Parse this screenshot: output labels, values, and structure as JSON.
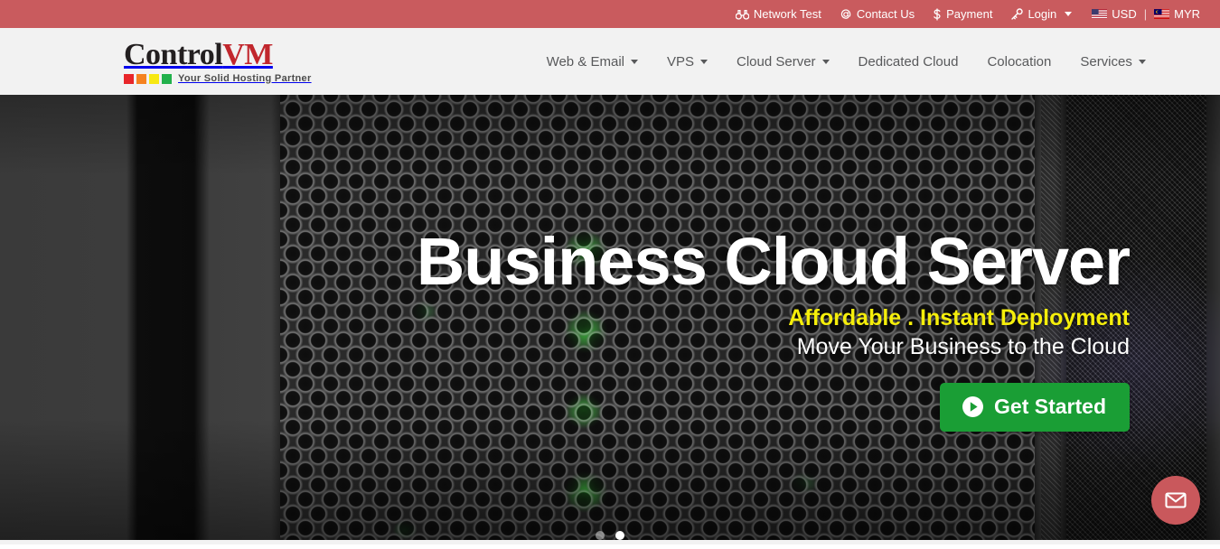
{
  "topbar": {
    "items": [
      {
        "label": "Network Test",
        "icon": "binoculars-icon"
      },
      {
        "label": "Contact Us",
        "icon": "at-sign-icon"
      },
      {
        "label": "Payment",
        "icon": "dollar-sign-icon"
      },
      {
        "label": "Login",
        "icon": "key-icon",
        "has_caret": true
      }
    ],
    "currencies": [
      {
        "label": "USD",
        "flag": "us-flag-icon"
      },
      {
        "label": "MYR",
        "flag": "my-flag-icon"
      }
    ],
    "separator": "|",
    "bg_color": "#c95b5e"
  },
  "header": {
    "logo": {
      "part1": "Control",
      "part2": "VM",
      "tagline": "Your Solid Hosting Partner",
      "squares": [
        "#e8262a",
        "#f58220",
        "#f7e812",
        "#22b14c"
      ]
    },
    "nav": [
      {
        "label": "Web & Email",
        "has_caret": true
      },
      {
        "label": "VPS",
        "has_caret": true
      },
      {
        "label": "Cloud Server",
        "has_caret": true
      },
      {
        "label": "Dedicated Cloud",
        "has_caret": false
      },
      {
        "label": "Colocation",
        "has_caret": false
      },
      {
        "label": "Services",
        "has_caret": true
      }
    ],
    "bg_color": "#f2f2f2",
    "nav_color": "#58595b"
  },
  "hero": {
    "title": "Business Cloud Server",
    "subtitle_highlight": "Affordable . Instant Deployment",
    "subtitle": "Move Your Business to the Cloud",
    "cta_label": "Get Started",
    "cta_icon": "play-circle-icon",
    "cta_color": "#1a9e35",
    "highlight_color": "#f5ee0b",
    "slides": [
      {
        "active": false
      },
      {
        "active": true
      }
    ]
  },
  "fab": {
    "icon": "mail-icon",
    "color": "#c9585c"
  }
}
